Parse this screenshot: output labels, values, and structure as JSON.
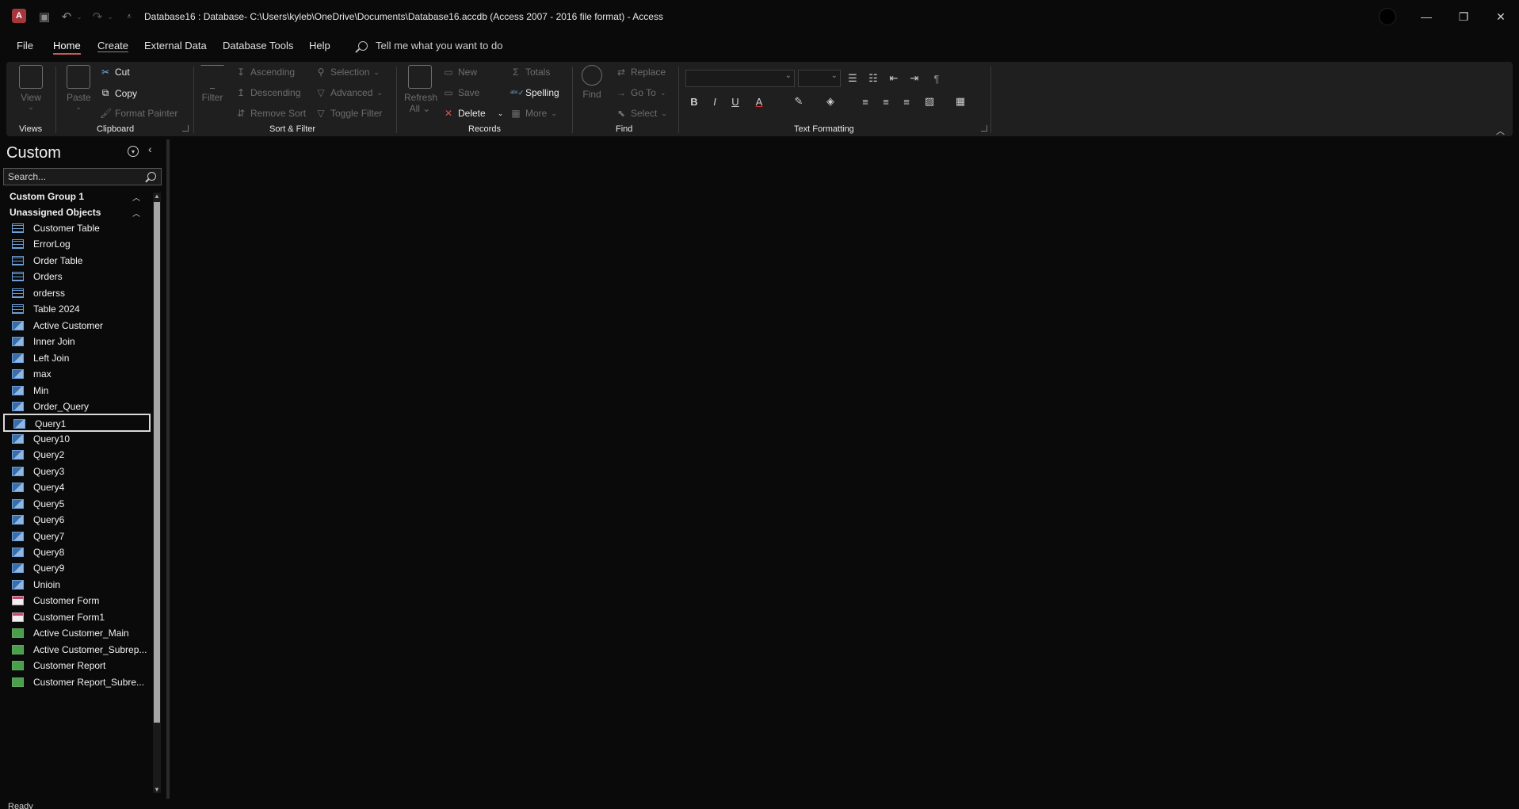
{
  "window": {
    "title": "Database16 : Database- C:\\Users\\kyleb\\OneDrive\\Documents\\Database16.accdb (Access 2007 - 2016 file format)  -  Access",
    "app_letter": "A"
  },
  "tabs": [
    "File",
    "Home",
    "Create",
    "External Data",
    "Database Tools",
    "Help"
  ],
  "tell_me": "Tell me what you want to do",
  "ribbon": {
    "views": {
      "label": "Views",
      "view_btn": "View"
    },
    "clipboard": {
      "label": "Clipboard",
      "paste": "Paste",
      "cut": "Cut",
      "copy": "Copy",
      "format_painter": "Format Painter"
    },
    "sort_filter": {
      "label": "Sort & Filter",
      "filter": "Filter",
      "ascending": "Ascending",
      "descending": "Descending",
      "remove_sort": "Remove Sort",
      "selection": "Selection",
      "advanced": "Advanced",
      "toggle_filter": "Toggle Filter"
    },
    "records": {
      "label": "Records",
      "refresh": "Refresh",
      "refresh_all": "All",
      "new": "New",
      "save": "Save",
      "delete": "Delete",
      "totals": "Totals",
      "spelling": "Spelling",
      "more": "More"
    },
    "find": {
      "label": "Find",
      "find": "Find",
      "replace": "Replace",
      "go_to": "Go To",
      "select": "Select"
    },
    "text_formatting": {
      "label": "Text Formatting",
      "bold": "B",
      "italic": "I",
      "underline": "U",
      "font_color": "A"
    }
  },
  "nav": {
    "title": "Custom",
    "search_placeholder": "Search...",
    "groups": [
      "Custom Group 1",
      "Unassigned Objects"
    ],
    "items": [
      {
        "type": "table",
        "label": "Customer Table"
      },
      {
        "type": "table",
        "label": "ErrorLog"
      },
      {
        "type": "table",
        "label": "Order Table"
      },
      {
        "type": "table",
        "label": "Orders"
      },
      {
        "type": "table",
        "label": "orderss"
      },
      {
        "type": "table",
        "label": "Table 2024"
      },
      {
        "type": "query",
        "label": "Active Customer"
      },
      {
        "type": "query",
        "label": "Inner Join"
      },
      {
        "type": "query",
        "label": "Left Join"
      },
      {
        "type": "query",
        "label": "max"
      },
      {
        "type": "query",
        "label": "Min"
      },
      {
        "type": "query",
        "label": "Order_Query"
      },
      {
        "type": "query",
        "label": "Query1"
      },
      {
        "type": "query",
        "label": "Query10"
      },
      {
        "type": "query",
        "label": "Query2"
      },
      {
        "type": "query",
        "label": "Query3"
      },
      {
        "type": "query",
        "label": "Query4"
      },
      {
        "type": "query",
        "label": "Query5"
      },
      {
        "type": "query",
        "label": "Query6"
      },
      {
        "type": "query",
        "label": "Query7"
      },
      {
        "type": "query",
        "label": "Query8"
      },
      {
        "type": "query",
        "label": "Query9"
      },
      {
        "type": "query",
        "label": "Unioin"
      },
      {
        "type": "form",
        "label": "Customer Form"
      },
      {
        "type": "form",
        "label": "Customer Form1"
      },
      {
        "type": "report",
        "label": "Active Customer_Main"
      },
      {
        "type": "report",
        "label": "Active Customer_Subrep..."
      },
      {
        "type": "report",
        "label": "Customer Report"
      },
      {
        "type": "report",
        "label": "Customer Report_Subre..."
      }
    ],
    "selected_index": 12
  },
  "status": {
    "text": "Ready"
  }
}
